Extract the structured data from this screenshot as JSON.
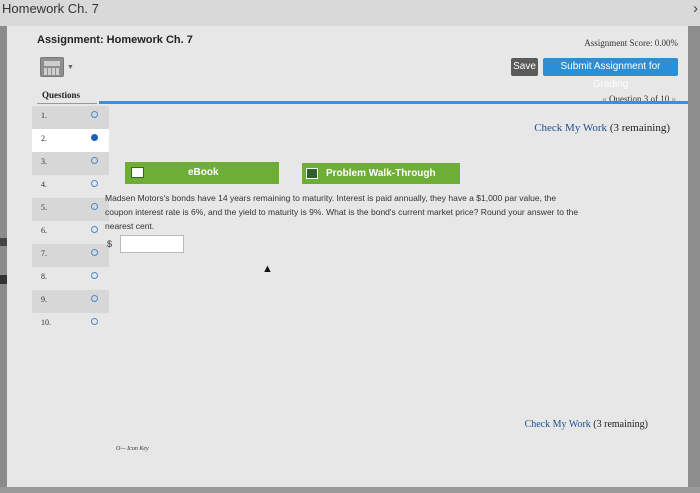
{
  "window": {
    "title": "Homework Ch. 7",
    "chevron": "›"
  },
  "header": {
    "assignment_title": "Assignment: Homework Ch. 7",
    "assignment_score": "Assignment Score: 0.00%"
  },
  "toolbar": {
    "calculator_icon": "calculator-icon",
    "save_label": "Save",
    "submit_label": "Submit Assignment for Grading"
  },
  "sidebar": {
    "heading": "Questions",
    "items": [
      {
        "number": "1.",
        "status": "unanswered"
      },
      {
        "number": "2.",
        "status": "current"
      },
      {
        "number": "3.",
        "status": "unanswered"
      },
      {
        "number": "4.",
        "status": "unanswered"
      },
      {
        "number": "5.",
        "status": "unanswered"
      },
      {
        "number": "6.",
        "status": "unanswered"
      },
      {
        "number": "7.",
        "status": "unanswered"
      },
      {
        "number": "8.",
        "status": "unanswered"
      },
      {
        "number": "9.",
        "status": "unanswered"
      },
      {
        "number": "10.",
        "status": "unanswered"
      }
    ]
  },
  "navigation": {
    "prev_arrow": "«",
    "label": "Question 3 of 10",
    "next_arrow": "»"
  },
  "check_work": {
    "label": "Check My Work",
    "remaining": "(3 remaining)"
  },
  "resources": {
    "ebook_label": "eBook",
    "walkthrough_label": "Problem Walk-Through"
  },
  "question": {
    "line1": "Madsen Motors's bonds have 14 years remaining to maturity. Interest is paid annually, they have a $1,000 par value, the",
    "line2": "coupon interest rate is 6%, and the yield to maturity is 9%. What is the bond's current market price? Round your answer to the",
    "line3": "nearest cent.",
    "currency_symbol": "$",
    "answer_value": ""
  },
  "footer": {
    "icon_key_symbol": "O—",
    "icon_key_label": "Icon Key"
  },
  "colors": {
    "accent_blue": "#2a8fd4",
    "resource_green": "#6eae36",
    "link_blue": "#1c4f8f"
  }
}
